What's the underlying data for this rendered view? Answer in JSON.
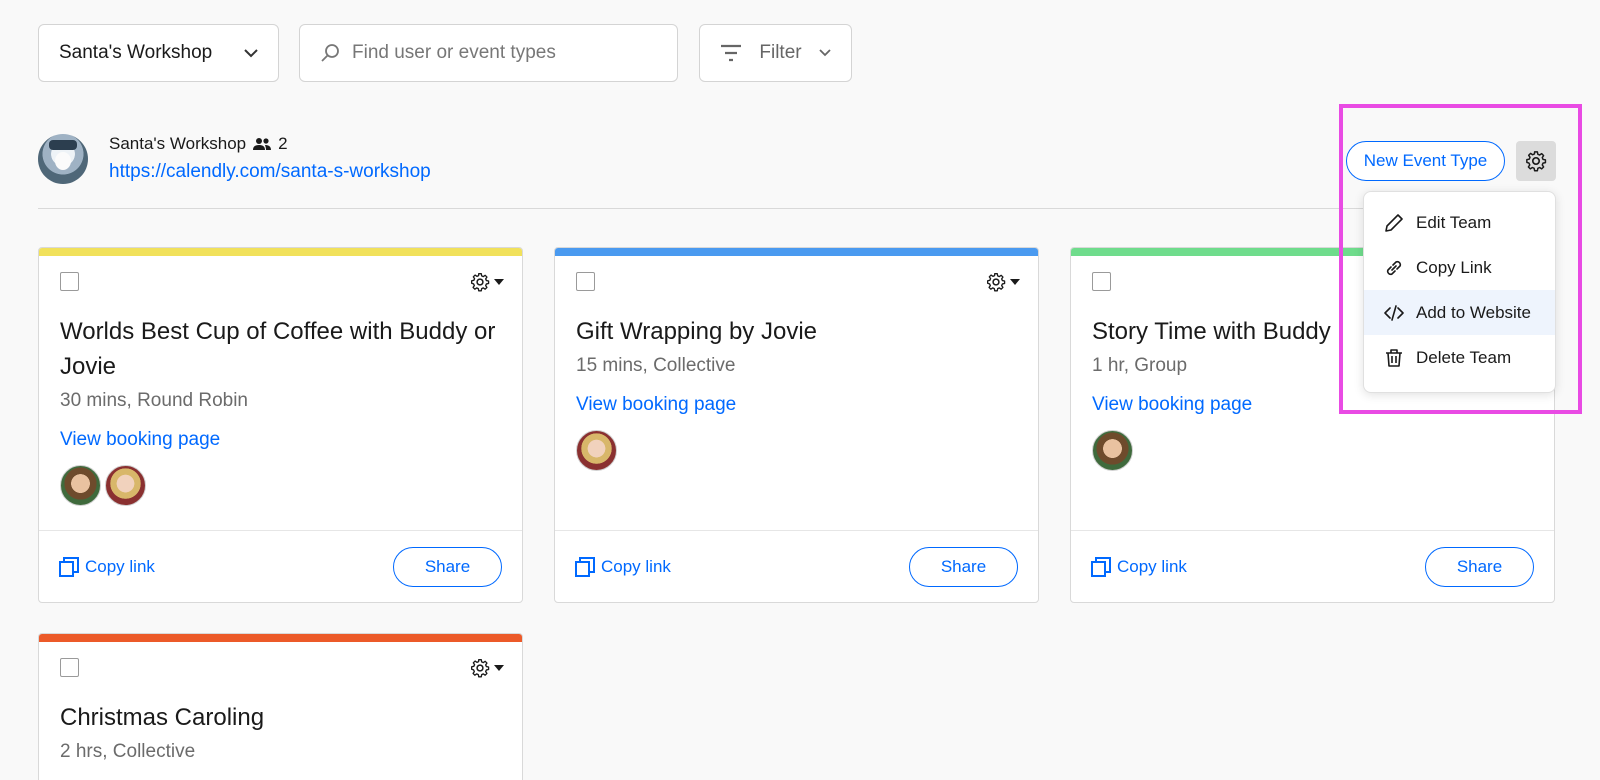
{
  "toolbar": {
    "team_select": "Santa's Workshop",
    "search_placeholder": "Find user or event types",
    "filter_label": "Filter"
  },
  "team": {
    "name": "Santa's Workshop",
    "member_count": "2",
    "url": "https://calendly.com/santa-s-workshop",
    "new_event_label": "New Event Type"
  },
  "team_menu": {
    "items": [
      {
        "label": "Edit Team",
        "icon": "pencil-icon"
      },
      {
        "label": "Copy Link",
        "icon": "link-icon"
      },
      {
        "label": "Add to Website",
        "icon": "code-icon"
      },
      {
        "label": "Delete Team",
        "icon": "trash-icon"
      }
    ],
    "hovered_index": 2
  },
  "colors": {
    "accent": "#0069ff",
    "highlight": "#e94be4"
  },
  "cards": [
    {
      "title": "Worlds Best Cup of Coffee with Buddy or Jovie",
      "meta": "30 mins, Round Robin",
      "booking_link": "View booking page",
      "copy_link": "Copy link",
      "share": "Share",
      "color": "#f1e15b",
      "hosts": [
        "buddy",
        "jovie"
      ]
    },
    {
      "title": "Gift Wrapping by Jovie",
      "meta": "15 mins, Collective",
      "booking_link": "View booking page",
      "copy_link": "Copy link",
      "share": "Share",
      "color": "#4a9af0",
      "hosts": [
        "jovie"
      ]
    },
    {
      "title": "Story Time with Buddy",
      "meta": "1 hr, Group",
      "booking_link": "View booking page",
      "copy_link": "Copy link",
      "share": "Share",
      "color": "#6fdc8c",
      "hosts": [
        "buddy"
      ]
    },
    {
      "title": "Christmas Caroling",
      "meta": "2 hrs, Collective",
      "color": "#ec5a29"
    }
  ]
}
